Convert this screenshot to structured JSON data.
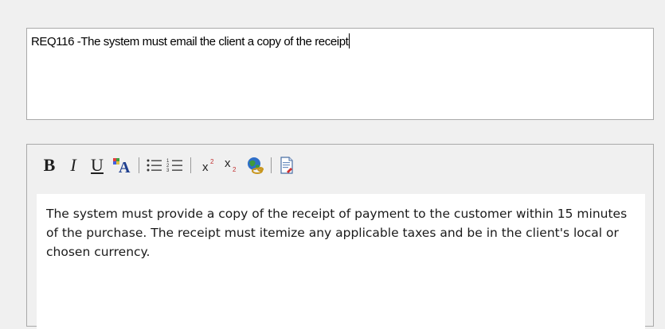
{
  "requirement": {
    "name_text": "REQ116 -The system must email the client a copy of the receipt"
  },
  "notes_editor": {
    "toolbar": {
      "bold_label": "B",
      "italic_label": "I",
      "underline_label": "U",
      "icons": [
        "font-color-icon",
        "bullet-list-icon",
        "numbered-list-icon",
        "superscript-icon",
        "subscript-icon",
        "hyperlink-globe-icon",
        "document-icon"
      ]
    },
    "text": "The system must provide a copy of the receipt of payment to the customer within 15 minutes of the purchase. The receipt must itemize any applicable taxes and be in the client's local or chosen currency."
  }
}
